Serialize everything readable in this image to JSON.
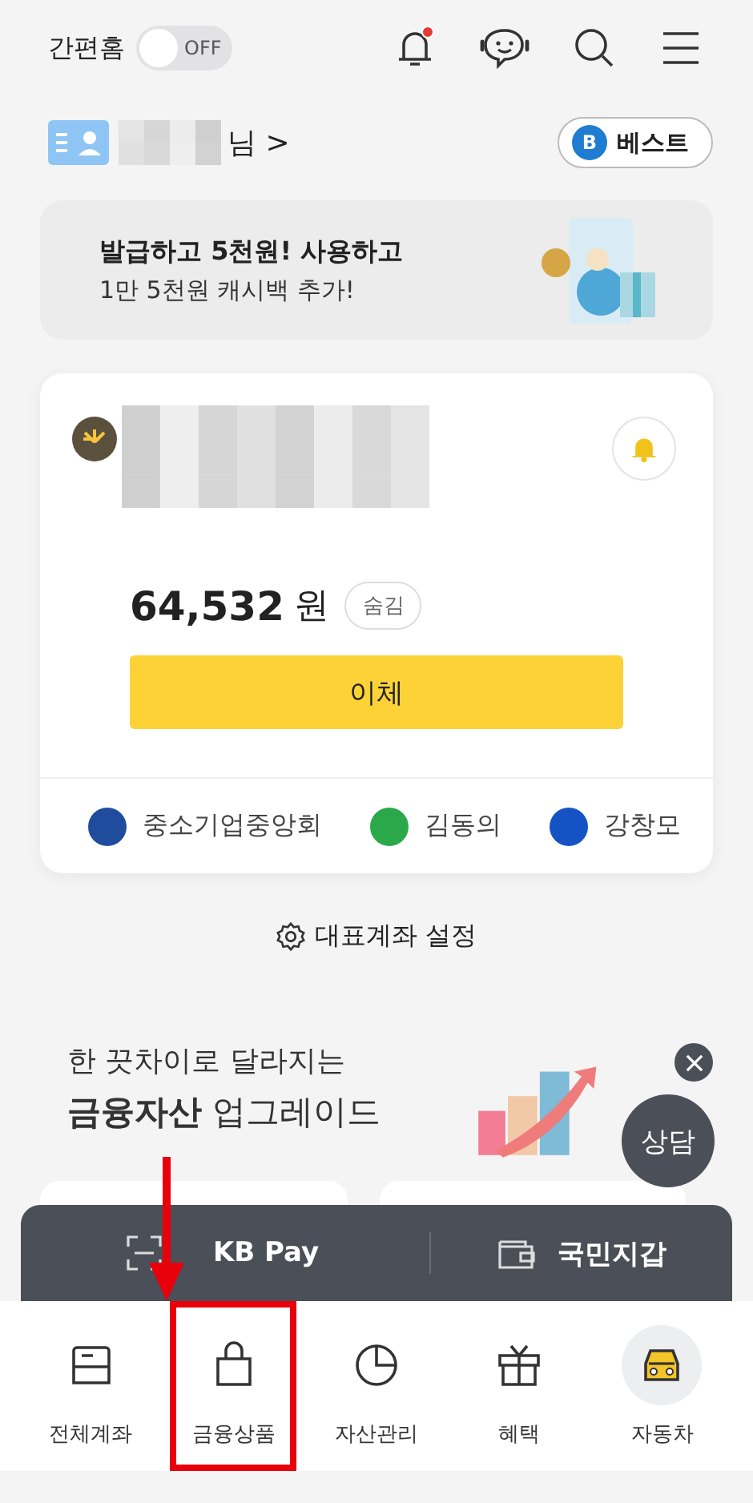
{
  "header": {
    "home_label": "간편홈",
    "toggle": {
      "label": "OFF",
      "on": false
    },
    "notification_dot": true
  },
  "profile": {
    "suffix": "님",
    "chevron": ">",
    "grade": {
      "letter": "B",
      "label": "베스트"
    }
  },
  "promo": {
    "line1": "발급하고 5천원! 사용하고",
    "line2": "1만 5천원 캐시백 추가!"
  },
  "account": {
    "balance": "64,532",
    "unit": "원",
    "hide_label": "숨김",
    "transfer_label": "이체",
    "favorites": [
      {
        "name": "중소기업중앙회",
        "color": "#1f4c9c"
      },
      {
        "name": "김동의",
        "color": "#2aa84a"
      },
      {
        "name": "강창모",
        "color": "#1553c4"
      }
    ]
  },
  "settings_link": "대표계좌 설정",
  "banner": {
    "line1": "한 끗차이로 달라지는",
    "bold": "금융자산",
    "rest": "업그레이드",
    "consult": "상담"
  },
  "quick_bar": [
    {
      "label": "KB Pay",
      "kind": "scan"
    },
    {
      "label": "국민지갑",
      "kind": "wallet"
    }
  ],
  "nav": [
    {
      "label": "전체계좌",
      "highlighted": false,
      "circled": false
    },
    {
      "label": "금융상품",
      "highlighted": true,
      "circled": false
    },
    {
      "label": "자산관리",
      "highlighted": false,
      "circled": false
    },
    {
      "label": "혜택",
      "highlighted": false,
      "circled": false
    },
    {
      "label": "자동차",
      "highlighted": false,
      "circled": true
    }
  ]
}
